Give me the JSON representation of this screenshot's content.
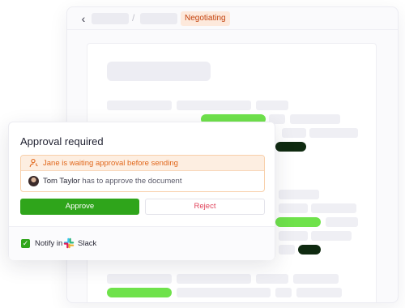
{
  "header": {
    "back_icon": "chevron-left-icon",
    "status_badge": "Negotiating",
    "status_color": "#c2410c"
  },
  "approval": {
    "title": "Approval required",
    "notice_icon": "user-clock-icon",
    "waiting_text": "Jane is waiting approval before sending",
    "approver_name": "Tom Taylor",
    "approver_suffix": " has to approve the document",
    "approve_label": "Approve",
    "reject_label": "Reject",
    "notify_label": "Notify in",
    "notify_checked": true,
    "integration_icon": "slack-icon",
    "integration_label": "Slack"
  },
  "colors": {
    "approve": "#2fa51b",
    "reject_text": "#e0425a",
    "notice_text": "#e0661a",
    "accent_green": "#6fe24b",
    "dark_green": "#0f2a10"
  }
}
